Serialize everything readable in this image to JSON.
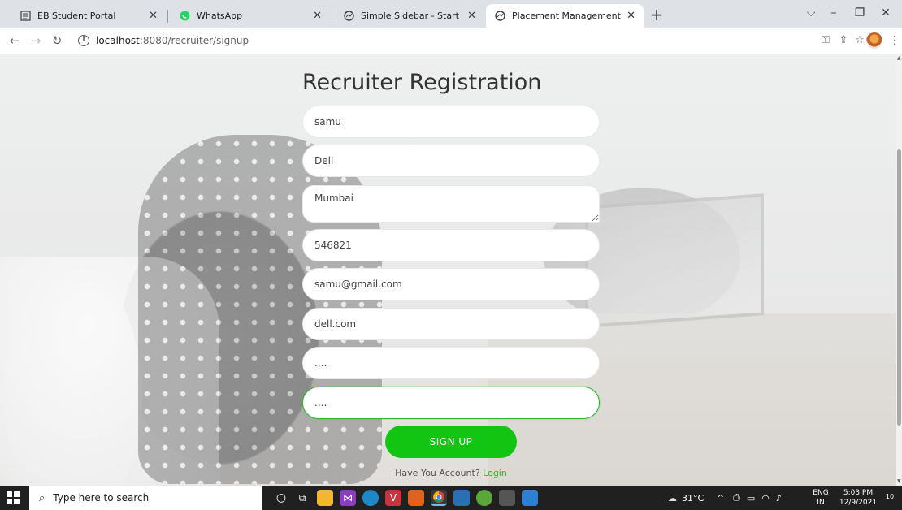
{
  "browser": {
    "tabs": [
      {
        "label": "EB Student Portal",
        "icon": "document-icon",
        "active": false
      },
      {
        "label": "WhatsApp",
        "icon": "whatsapp-icon",
        "active": false
      },
      {
        "label": "Simple Sidebar - Start Bootstrap",
        "icon": "globe-icon",
        "active": false
      },
      {
        "label": "Placement Management System",
        "icon": "globe-icon",
        "active": true
      }
    ],
    "url_host": "localhost",
    "url_path": ":8080/recruiter/signup"
  },
  "form": {
    "title": "Recruiter Registration",
    "fields": {
      "name": "samu",
      "company": "Dell",
      "address": "Mumbai",
      "pincode": "546821",
      "email": "samu@gmail.com",
      "website": "dell.com",
      "password": "....",
      "confirm_password": "...."
    },
    "submit_label": "SIGN UP",
    "account_text": "Have You Account?",
    "login_link": "Login"
  },
  "taskbar": {
    "search_placeholder": "Type here to search",
    "weather": "31°C",
    "lang_top": "ENG",
    "lang_bottom": "IN",
    "time": "5:03 PM",
    "date": "12/9/2021",
    "notifications": "10"
  },
  "colors": {
    "accent_green": "#13c513",
    "focus_green": "#2fbd2f"
  }
}
